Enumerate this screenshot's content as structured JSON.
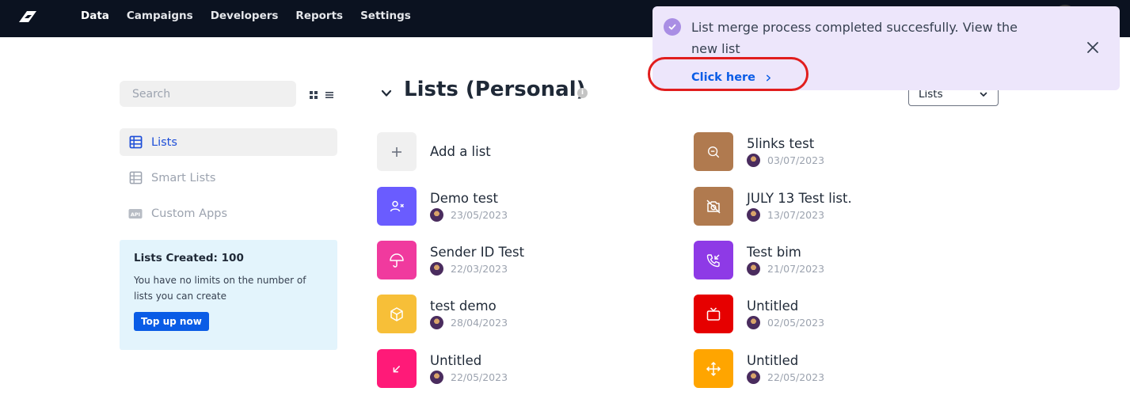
{
  "nav": {
    "items": [
      "Data",
      "Campaigns",
      "Developers",
      "Reports",
      "Settings"
    ],
    "logo": "brand-logo",
    "avatar": "user-avatar"
  },
  "sidebar": {
    "search_placeholder": "Search",
    "items": [
      {
        "label": "Lists",
        "icon": "table-icon",
        "active": true
      },
      {
        "label": "Smart Lists",
        "icon": "table-icon",
        "active": false
      },
      {
        "label": "Custom Apps",
        "icon": "api-icon",
        "active": false
      }
    ],
    "card": {
      "title": "Lists Created: 100",
      "text": "You have no limits on the number of lists you can create",
      "button": "Top up now"
    }
  },
  "main": {
    "title": "Lists (Personal)",
    "filter_value": "Lists",
    "add_label": "Add a list"
  },
  "lists": [
    {
      "name": "Demo test",
      "date": "23/05/2023",
      "color": "#6a5cff",
      "icon": "user-x-icon"
    },
    {
      "name": "Sender ID Test",
      "date": "22/03/2023",
      "color": "#f03a9e",
      "icon": "umbrella-icon"
    },
    {
      "name": "test demo",
      "date": "28/04/2023",
      "color": "#f7bf38",
      "icon": "box-icon"
    },
    {
      "name": "Untitled",
      "date": "22/05/2023",
      "color": "#ff1a78",
      "icon": "arrow-down-left-icon"
    },
    {
      "name": "5links test",
      "date": "03/07/2023",
      "color": "#b07a4f",
      "icon": "zoom-out-icon"
    },
    {
      "name": "JULY 13 Test list.",
      "date": "13/07/2023",
      "color": "#b07a4f",
      "icon": "camera-off-icon"
    },
    {
      "name": "Test bim",
      "date": "21/07/2023",
      "color": "#8e3ae6",
      "icon": "phone-incoming-icon"
    },
    {
      "name": "Untitled",
      "date": "02/05/2023",
      "color": "#e60000",
      "icon": "tv-icon"
    },
    {
      "name": "Untitled",
      "date": "22/05/2023",
      "color": "#ffa500",
      "icon": "move-icon"
    }
  ],
  "toast": {
    "message": "List merge process completed succesfully. View the new list",
    "link": "Click here"
  },
  "colors": {
    "accent": "#0a5ce6",
    "highlight": "#e11d1d",
    "toast_bg": "#ede6fb"
  }
}
